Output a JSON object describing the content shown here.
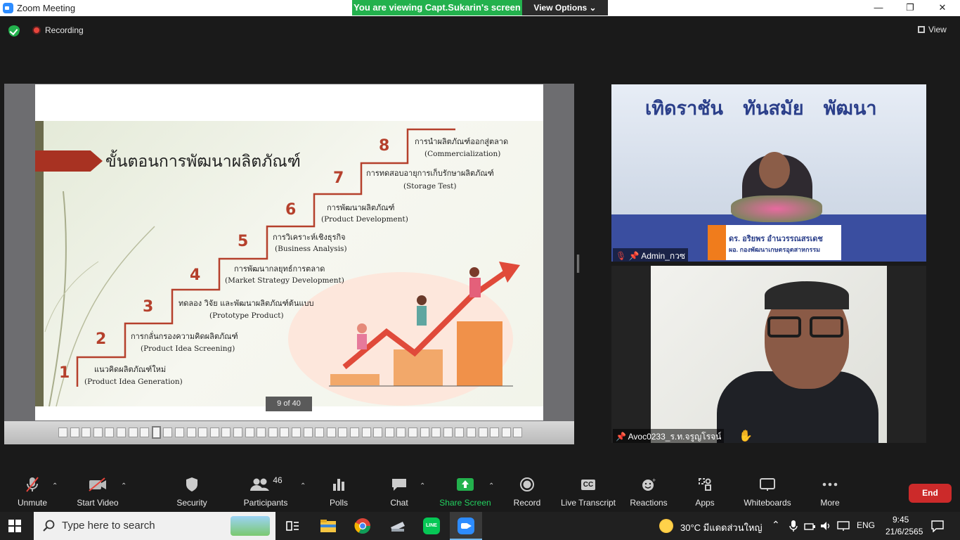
{
  "window": {
    "title": "Zoom Meeting",
    "minimize": "—",
    "restore": "❐",
    "close": "✕"
  },
  "banner": {
    "viewing": "You are viewing Capt.Sukarin's screen",
    "view_options": "View Options ⌄"
  },
  "topbar": {
    "recording": "Recording",
    "view": "View"
  },
  "slide": {
    "title": "ขั้นตอนการพัฒนาผลิตภัณฑ์",
    "page_counter": "9 of 40",
    "steps": [
      {
        "num": "1",
        "th": "แนวคิดผลิตภัณฑ์ใหม่",
        "en": "(Product Idea Generation)"
      },
      {
        "num": "2",
        "th": "การกลั่นกรองความคิดผลิตภัณฑ์",
        "en": "(Product Idea Screening)"
      },
      {
        "num": "3",
        "th": "ทดลอง วิจัย และพัฒนาผลิตภัณฑ์ต้นแบบ",
        "en": "(Prototype Product)"
      },
      {
        "num": "4",
        "th": "การพัฒนากลยุทธ์การตลาด",
        "en": "(Market Strategy Development)"
      },
      {
        "num": "5",
        "th": "การวิเคราะห์เชิงธุรกิจ",
        "en": "(Business Analysis)"
      },
      {
        "num": "6",
        "th": "การพัฒนาผลิตภัณฑ์",
        "en": "(Product Development)"
      },
      {
        "num": "7",
        "th": "การทดสอบอายุการเก็บรักษาผลิตภัณฑ์",
        "en": "(Storage Test)"
      },
      {
        "num": "8",
        "th": "การนำผลิตภัณฑ์ออกสู่ตลาด",
        "en": "(Commercialization)"
      }
    ]
  },
  "participants": [
    {
      "name": "Admin_กวซ",
      "banner_text": "เทิดราชัน   ทันสมัย   พัฒนา",
      "plate_line1": "ดร. อริยพร  อำนวรรณสรเดช",
      "plate_line2": "ผอ. กองพัฒนาเกษตรอุตสาหกรรม"
    },
    {
      "name": "Avoc0233_ร.ท.จรูญโรจน์"
    }
  ],
  "toolbar": {
    "unmute": "Unmute",
    "start_video": "Start Video",
    "security": "Security",
    "participants": "Participants",
    "participants_count": "46",
    "polls": "Polls",
    "chat": "Chat",
    "share_screen": "Share Screen",
    "record": "Record",
    "live_transcript": "Live Transcript",
    "cc": "CC",
    "reactions": "Reactions",
    "apps": "Apps",
    "whiteboards": "Whiteboards",
    "more": "More",
    "end": "End"
  },
  "taskbar": {
    "search_placeholder": "Type here to search",
    "weather": "30°C  มีแดดส่วนใหญ่",
    "lang": "ENG",
    "time": "9:45",
    "date": "21/6/2565"
  },
  "colors": {
    "accent_green": "#23b14d",
    "end_red": "#cc2a2a",
    "slide_red": "#a83222"
  }
}
